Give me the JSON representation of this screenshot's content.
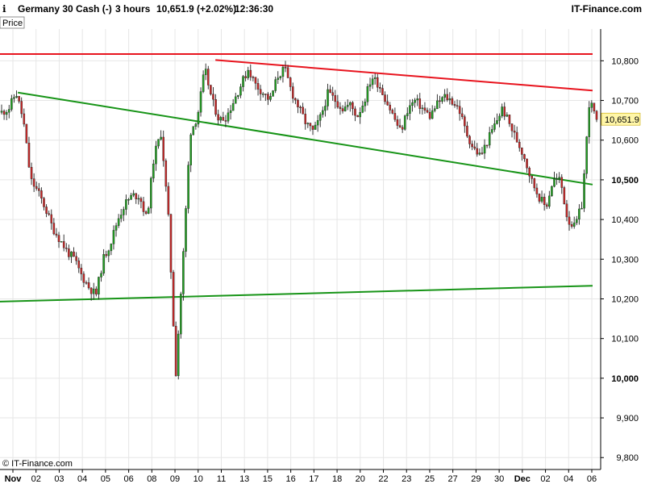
{
  "header": {
    "instrument": "Germany 30 Cash (-)",
    "timeframe": "3 hours",
    "price_change": "10,651.9 (+2.02%)",
    "time": "12:36:30",
    "brand": "IT-Finance.com"
  },
  "panel_tab": "Price",
  "copyright": "© IT-Finance.com",
  "last_price_label": "10,651.9",
  "colors": {
    "bull": "#22a022",
    "bear": "#c82828",
    "resistance": "#e8141e",
    "support": "#179417",
    "grid": "#e6e6e6",
    "label_bg": "#fff6a8"
  },
  "chart_data": {
    "type": "candlestick",
    "ylim": [
      9770,
      10880
    ],
    "y_ticks": [
      {
        "value": 10800,
        "label": "10,800",
        "bold": false
      },
      {
        "value": 10700,
        "label": "10,700",
        "bold": false
      },
      {
        "value": 10600,
        "label": "10,600",
        "bold": false
      },
      {
        "value": 10500,
        "label": "10,500",
        "bold": true
      },
      {
        "value": 10400,
        "label": "10,400",
        "bold": false
      },
      {
        "value": 10300,
        "label": "10,300",
        "bold": false
      },
      {
        "value": 10200,
        "label": "10,200",
        "bold": false
      },
      {
        "value": 10100,
        "label": "10,100",
        "bold": false
      },
      {
        "value": 10000,
        "label": "10,000",
        "bold": true
      },
      {
        "value": 9900,
        "label": "9,900",
        "bold": false
      },
      {
        "value": 9800,
        "label": "9,800",
        "bold": false
      }
    ],
    "x_ticks": [
      {
        "label": "Nov",
        "month": true
      },
      {
        "label": "02"
      },
      {
        "label": "03"
      },
      {
        "label": "04"
      },
      {
        "label": "05"
      },
      {
        "label": "06"
      },
      {
        "label": "08"
      },
      {
        "label": "09"
      },
      {
        "label": "10"
      },
      {
        "label": "11"
      },
      {
        "label": "13"
      },
      {
        "label": "15"
      },
      {
        "label": "16"
      },
      {
        "label": "17"
      },
      {
        "label": "18"
      },
      {
        "label": "20"
      },
      {
        "label": "22"
      },
      {
        "label": "23"
      },
      {
        "label": "25"
      },
      {
        "label": "27"
      },
      {
        "label": "29"
      },
      {
        "label": "30"
      },
      {
        "label": "Dec",
        "month": true
      },
      {
        "label": "02"
      },
      {
        "label": "04"
      },
      {
        "label": "06"
      }
    ],
    "trendlines": [
      {
        "name": "upper-resistance",
        "color": "resistance",
        "points": [
          [
            0,
            10817
          ],
          [
            1.1,
            10817
          ]
        ]
      },
      {
        "name": "falling-resistance",
        "color": "resistance",
        "points": [
          [
            0.362,
            10802
          ],
          [
            1.0,
            10725
          ]
        ]
      },
      {
        "name": "falling-support",
        "color": "support",
        "points": [
          [
            0.03,
            10720
          ],
          [
            1.02,
            10488
          ]
        ]
      },
      {
        "name": "rising-support",
        "color": "support",
        "points": [
          [
            0,
            10193
          ],
          [
            1.0,
            10233
          ]
        ]
      }
    ],
    "last_price": 10651.9,
    "candle_path": [
      10670,
      10680,
      10720,
      10650,
      10500,
      10470,
      10430,
      10380,
      10350,
      10320,
      10300,
      10260,
      10230,
      10210,
      10300,
      10340,
      10400,
      10440,
      10460,
      10460,
      10400,
      10560,
      10620,
      10400,
      10010,
      10300,
      10620,
      10660,
      10780,
      10700,
      10650,
      10660,
      10700,
      10740,
      10780,
      10740,
      10720,
      10700,
      10760,
      10780,
      10720,
      10680,
      10640,
      10620,
      10660,
      10720,
      10700,
      10680,
      10690,
      10660,
      10700,
      10760,
      10740,
      10700,
      10660,
      10620,
      10680,
      10700,
      10680,
      10660,
      10690,
      10710,
      10700,
      10680,
      10620,
      10580,
      10560,
      10600,
      10640,
      10680,
      10640,
      10600,
      10560,
      10500,
      10460,
      10430,
      10500,
      10500,
      10400,
      10380,
      10440,
      10700,
      10652
    ]
  }
}
